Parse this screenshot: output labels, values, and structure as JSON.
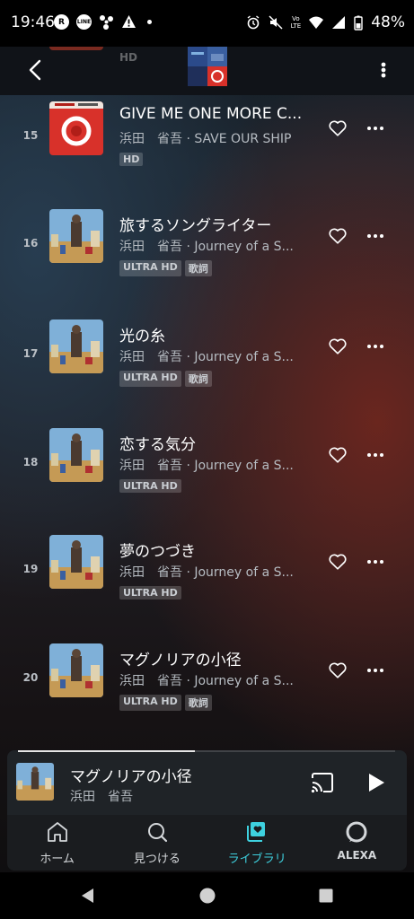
{
  "status_bar": {
    "time": "19:46",
    "battery": "48%",
    "network": "LTE"
  },
  "tracks": [
    {
      "number": "15",
      "title": "GIVE ME ONE MORE C...",
      "subtitle": "浜田　省吾 · SAVE OUR SHIP",
      "badges": [
        "HD"
      ],
      "art": "red"
    },
    {
      "number": "16",
      "title": "旅するソングライター",
      "subtitle": "浜田　省吾 · Journey of a S...",
      "badges": [
        "ULTRA HD",
        "歌詞"
      ],
      "art": "journey"
    },
    {
      "number": "17",
      "title": "光の糸",
      "subtitle": "浜田　省吾 · Journey of a S...",
      "badges": [
        "ULTRA HD",
        "歌詞"
      ],
      "art": "journey"
    },
    {
      "number": "18",
      "title": "恋する気分",
      "subtitle": "浜田　省吾 · Journey of a S...",
      "badges": [
        "ULTRA HD"
      ],
      "art": "journey"
    },
    {
      "number": "19",
      "title": "夢のつづき",
      "subtitle": "浜田　省吾 · Journey of a S...",
      "badges": [
        "ULTRA HD"
      ],
      "art": "journey"
    },
    {
      "number": "20",
      "title": "マグノリアの小径",
      "subtitle": "浜田　省吾 · Journey of a S...",
      "badges": [
        "ULTRA HD",
        "歌詞"
      ],
      "art": "journey"
    }
  ],
  "partial_row_badge": "HD",
  "now_playing": {
    "title": "マグノリアの小径",
    "artist": "浜田　省吾",
    "progress": 0.47
  },
  "nav": [
    {
      "label": "ホーム",
      "icon": "home-icon",
      "active": false
    },
    {
      "label": "見つける",
      "icon": "search-icon",
      "active": false
    },
    {
      "label": "ライブラリ",
      "icon": "library-icon",
      "active": true
    },
    {
      "label": "ALEXA",
      "icon": "alexa-icon",
      "active": false
    }
  ],
  "colors": {
    "accent": "#3ed1df",
    "art_red": "#d8312a",
    "badge_bg": "#3a3d42"
  }
}
